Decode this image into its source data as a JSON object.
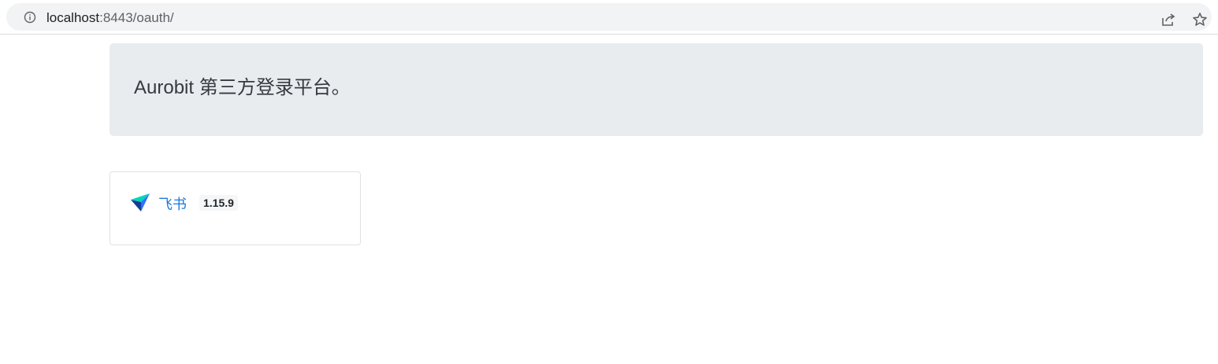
{
  "browser": {
    "url_host": "localhost",
    "url_rest": ":8443/oauth/",
    "icons": {
      "info": "info-icon",
      "share": "share-icon",
      "bookmark": "star-icon"
    }
  },
  "header": {
    "text": "Aurobit 第三方登录平台。"
  },
  "providers": [
    {
      "name": "飞书",
      "version": "1.15.9",
      "icon": "feishu-icon"
    }
  ],
  "colors": {
    "link": "#1a7be0",
    "jumbotron_bg": "#e9ecef",
    "omnibox_bg": "#f1f3f4"
  }
}
